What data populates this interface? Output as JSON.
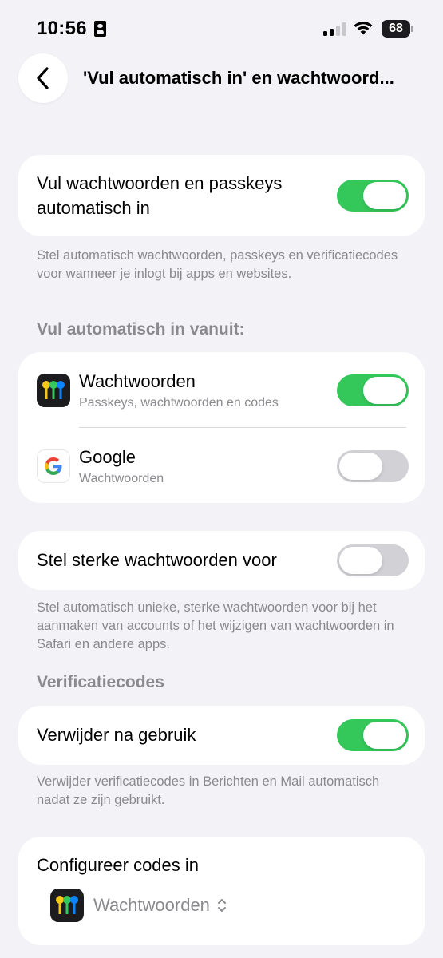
{
  "status": {
    "time": "10:56",
    "battery": "68"
  },
  "nav": {
    "title": "'Vul automatisch in' en wachtwoord..."
  },
  "autofill": {
    "label": "Vul wachtwoorden en passkeys automatisch in",
    "enabled": true,
    "footnote": "Stel automatisch wachtwoorden, passkeys en verificatiecodes voor wanneer je inlogt bij apps en websites."
  },
  "sources": {
    "header": "Vul automatisch in vanuit:",
    "items": [
      {
        "title": "Wachtwoorden",
        "subtitle": "Passkeys, wachtwoorden en codes",
        "icon": "passwords-app-icon",
        "enabled": true
      },
      {
        "title": "Google",
        "subtitle": "Wachtwoorden",
        "icon": "google-icon",
        "enabled": false
      }
    ]
  },
  "strong": {
    "label": "Stel sterke wachtwoorden voor",
    "enabled": false,
    "footnote": "Stel automatisch unieke, sterke wachtwoorden voor bij het aanmaken van accounts of het wijzigen van wachtwoorden in Safari en andere apps."
  },
  "codes": {
    "header": "Verificatiecodes",
    "delete_label": "Verwijder na gebruik",
    "delete_enabled": true,
    "footnote": "Verwijder verificatiecodes in Berichten en Mail automatisch nadat ze zijn gebruikt."
  },
  "configure": {
    "label": "Configureer codes in",
    "selected": "Wachtwoorden"
  },
  "colors": {
    "accent_green": "#34c759",
    "background": "#f2f2f7",
    "secondary_text": "#8a8a8e"
  }
}
